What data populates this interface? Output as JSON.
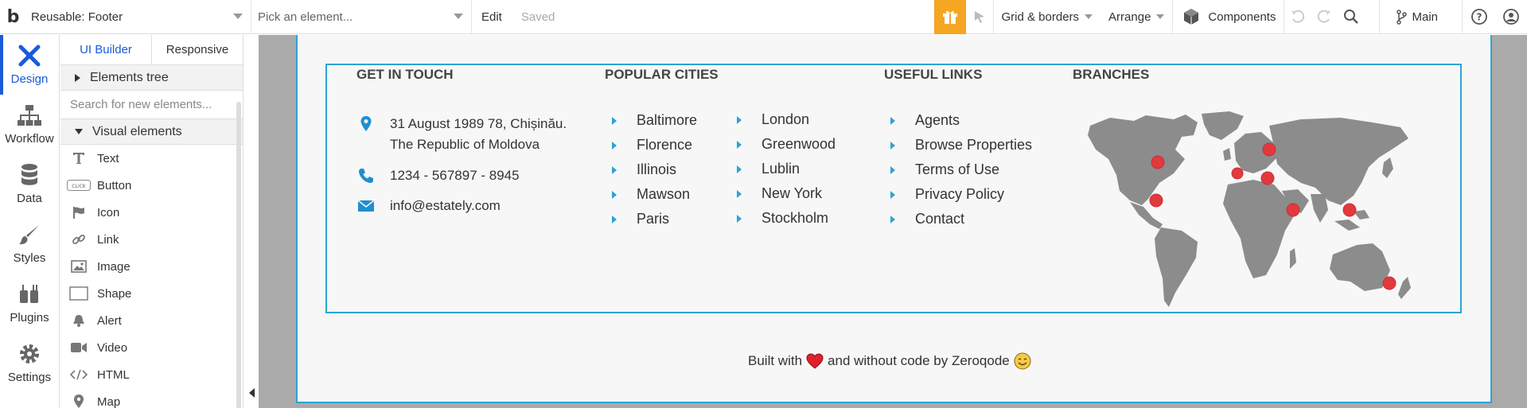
{
  "topbar": {
    "logo": "b",
    "page_selector": "Reusable: Footer",
    "element_picker_placeholder": "Pick an element...",
    "edit": "Edit",
    "saved": "Saved",
    "grid_borders": "Grid & borders",
    "arrange": "Arrange",
    "components": "Components",
    "branch": "Main"
  },
  "rail": {
    "design": "Design",
    "workflow": "Workflow",
    "data": "Data",
    "styles": "Styles",
    "plugins": "Plugins",
    "settings": "Settings"
  },
  "panel": {
    "tab_ui_builder": "UI Builder",
    "tab_responsive": "Responsive",
    "elements_tree": "Elements tree",
    "search_placeholder": "Search for new elements...",
    "visual_elements": "Visual elements",
    "items": [
      {
        "label": "Text",
        "icon": "text-icon"
      },
      {
        "label": "Button",
        "icon": "button-icon"
      },
      {
        "label": "Icon",
        "icon": "flag-icon"
      },
      {
        "label": "Link",
        "icon": "link-icon"
      },
      {
        "label": "Image",
        "icon": "image-icon"
      },
      {
        "label": "Shape",
        "icon": "shape-icon"
      },
      {
        "label": "Alert",
        "icon": "bell-icon"
      },
      {
        "label": "Video",
        "icon": "video-icon"
      },
      {
        "label": "HTML",
        "icon": "code-icon"
      },
      {
        "label": "Map",
        "icon": "map-pin-icon"
      }
    ]
  },
  "footer": {
    "get_in_touch": {
      "title": "GET IN TOUCH",
      "address_line1": "31 August 1989 78, Chișinău.",
      "address_line2": "The Republic of Moldova",
      "phone": "1234 - 567897 - 8945",
      "email": "info@estately.com"
    },
    "popular_cities": {
      "title": "POPULAR CITIES",
      "col1": [
        "Baltimore",
        "Florence",
        "Illinois",
        "Mawson",
        "Paris"
      ],
      "col2": [
        "London",
        "Greenwood",
        "Lublin",
        "New York",
        "Stockholm"
      ]
    },
    "useful_links": {
      "title": "USEFUL LINKS",
      "items": [
        "Agents",
        "Browse Properties",
        "Terms of Use",
        "Privacy Policy",
        "Contact"
      ]
    },
    "branches": {
      "title": "BRANCHES"
    },
    "built_with": {
      "before": "Built with",
      "after": "and without code by Zeroqode"
    }
  },
  "colors": {
    "accent_blue": "#1a5bd8",
    "border_cyan": "#2ea3d4",
    "gift_orange": "#f5a623",
    "marker_red": "#e0393e"
  }
}
